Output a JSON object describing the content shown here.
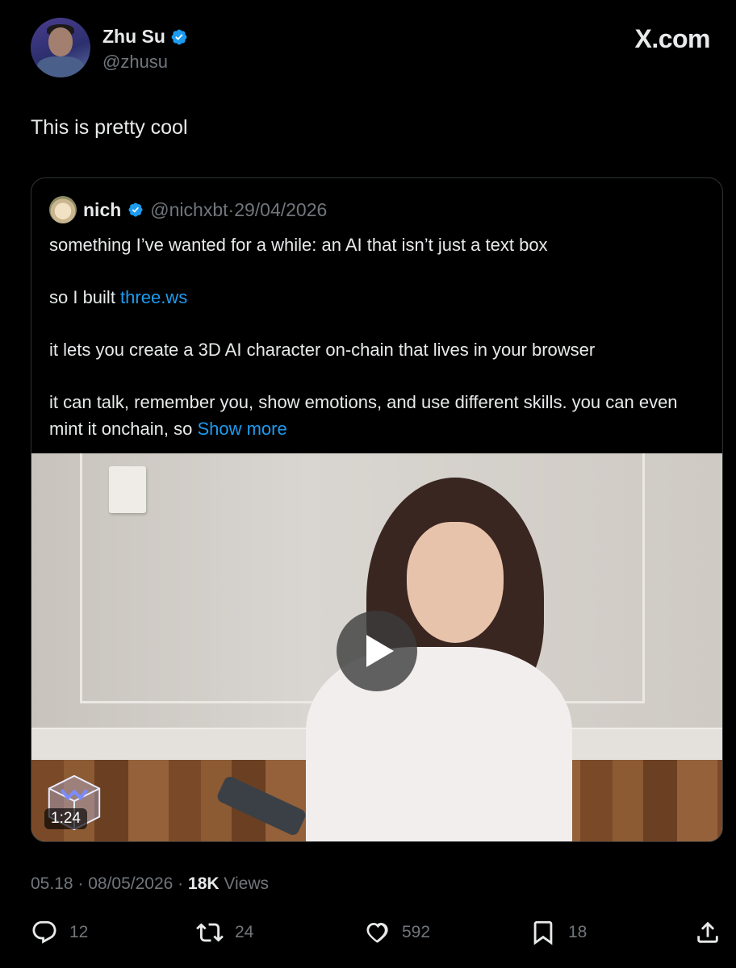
{
  "author": {
    "name": "Zhu Su",
    "handle": "@zhusu",
    "verified_color": "#1d9bf0"
  },
  "brand": "X.com",
  "tweet_text": "This is pretty cool",
  "quote": {
    "name": "nich",
    "handle": "@nichxbt",
    "sep": "·",
    "date": "29/04/2026",
    "line1": "something I’ve wanted for a while: an AI that isn’t just a text box",
    "line2_prefix": "so I built ",
    "line2_link": "three.ws",
    "line3": "it lets you create a 3D AI character on-chain that lives in your browser",
    "line4": "it can talk, remember you, show emotions, and use different skills. you can even mint it onchain, so ",
    "show_more": "Show more",
    "video": {
      "duration": "1:24",
      "play_icon": "play-icon"
    }
  },
  "meta": {
    "time": "05.18",
    "sep1": " · ",
    "date": "08/05/2026",
    "sep2": " · ",
    "views_count": "18K",
    "views_label": " Views"
  },
  "actions": {
    "replies": "12",
    "reposts": "24",
    "likes": "592",
    "bookmarks": "18"
  },
  "colors": {
    "background": "#000000",
    "text": "#e7e9ea",
    "muted": "#71767b",
    "link": "#1d9bf0",
    "border": "#2f3336"
  }
}
